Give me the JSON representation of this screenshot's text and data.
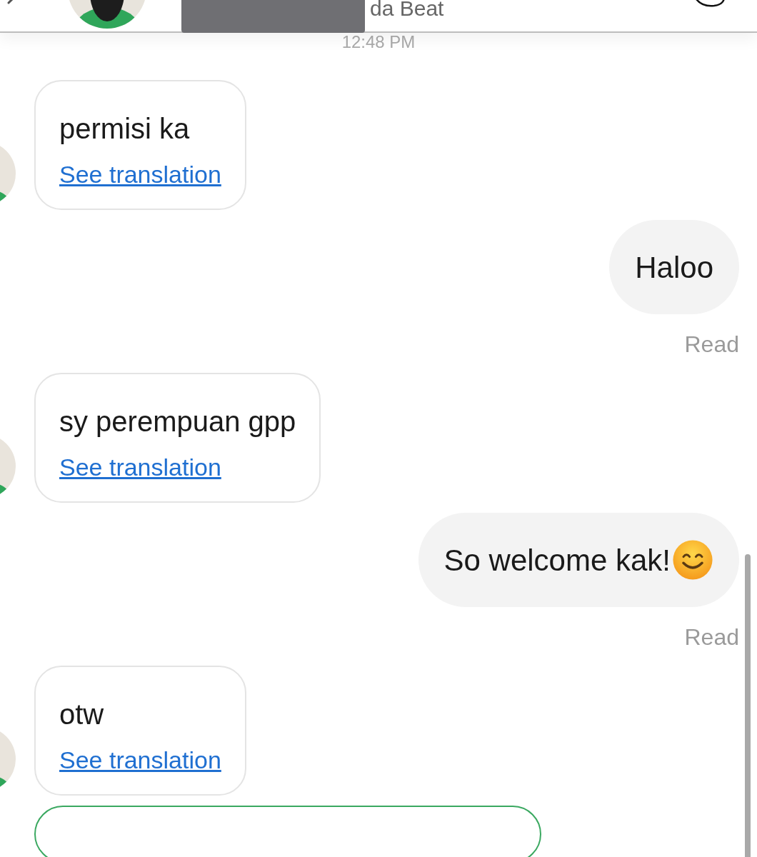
{
  "header": {
    "name": "da Beat",
    "time": "12:48 PM"
  },
  "messages": [
    {
      "kind": "incoming",
      "text": "permisi ka",
      "link": "See translation"
    },
    {
      "kind": "outgoing",
      "text": "Haloo",
      "emoji": false,
      "status": "Read"
    },
    {
      "kind": "incoming",
      "text": "sy perempuan gpp",
      "link": "See translation"
    },
    {
      "kind": "outgoing",
      "text": "So welcome kak!",
      "emoji": true,
      "status": "Read"
    },
    {
      "kind": "incoming",
      "text": "otw",
      "link": "See translation"
    },
    {
      "kind": "cut"
    }
  ]
}
